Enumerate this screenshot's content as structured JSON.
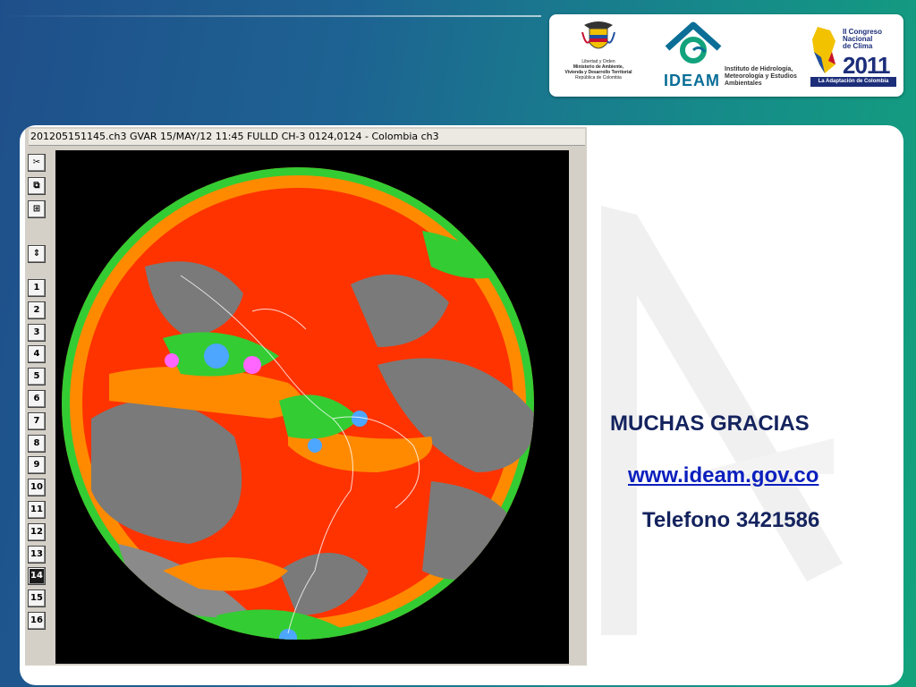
{
  "header": {
    "logos": [
      {
        "name": "ministry-logo",
        "lines": [
          "Libertad y Orden",
          "Ministerio de Ambiente,",
          "Vivienda y Desarrollo Territorial",
          "República de Colombia"
        ]
      },
      {
        "name": "ideam-logo",
        "word": "IDEAM",
        "description": "Instituto de Hidrología, Meteorología y Estudios Ambientales"
      },
      {
        "name": "congreso-logo",
        "title_lines": [
          "II Congreso",
          "Nacional",
          "de Clima"
        ],
        "year": "2011",
        "tagline": "La Adaptación de Colombia"
      }
    ]
  },
  "viewer": {
    "title": "201205151145.ch3 GVAR 15/MAY/12 11:45 FULLD CH-3 0124,0124 - Colombia ch3",
    "tools": [
      {
        "icon": "scissors-icon",
        "glyph": "✂"
      },
      {
        "icon": "copy-icon",
        "glyph": "⧉"
      },
      {
        "icon": "layout-icon",
        "glyph": "⊞"
      },
      {
        "icon": "scroll-arrows-icon",
        "glyph": "⇕"
      }
    ],
    "frame_buttons": [
      "1",
      "2",
      "3",
      "4",
      "5",
      "6",
      "7",
      "8",
      "9",
      "10",
      "11",
      "12",
      "13",
      "14",
      "15",
      "16"
    ],
    "active_frame": "14"
  },
  "closing": {
    "thanks": "MUCHAS GRACIAS",
    "website": "www.ideam.gov.co",
    "phone": "Telefono 3421586"
  },
  "colors": {
    "title_text": "#14235e",
    "link": "#0b1fbd",
    "ideam_blue": "#0a6e96",
    "satellite_palette": [
      "#7a7a7a",
      "#ff3300",
      "#ff8a00",
      "#33cc33",
      "#4da6ff",
      "#ff66ff"
    ]
  }
}
